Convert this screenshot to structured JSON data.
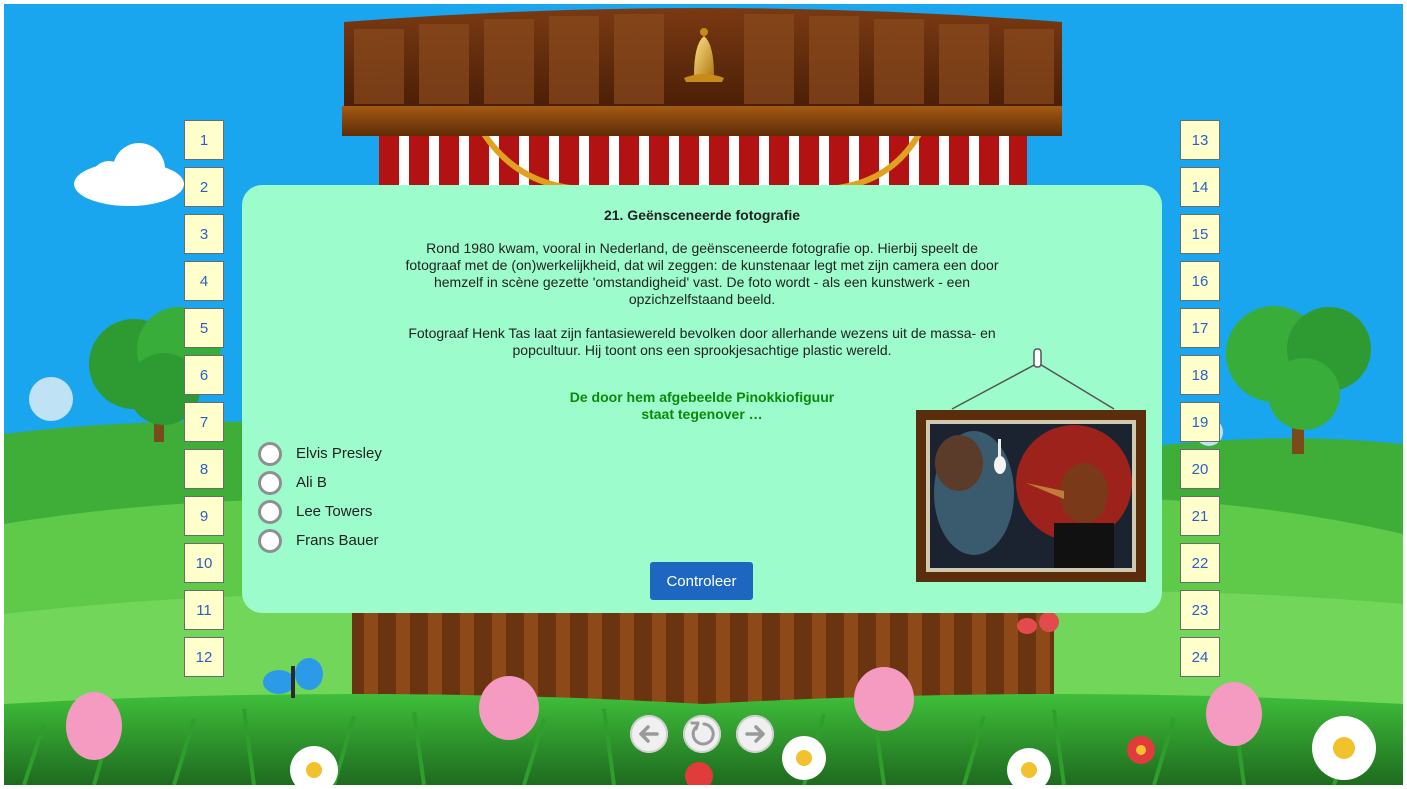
{
  "question": {
    "title": "21. Geënsceneerde fotografie",
    "paragraph1": "Rond 1980 kwam, vooral in Nederland, de geënsceneerde fotografie op. Hierbij speelt de fotograaf met de (on)werkelijkheid, dat wil zeggen: de kunstenaar legt met zijn camera een door hemzelf in scène gezette 'omstandigheid' vast. De foto wordt - als een kunstwerk - een opzichzelfstaand beeld.",
    "paragraph2": "Fotograaf Henk Tas laat zijn fantasiewereld bevolken door allerhande wezens uit de massa- en popcultuur. Hij toont ons een sprookjesachtige plastic wereld.",
    "prompt": "De door hem afgebeelde Pinokkiofiguur\nstaat tegenover …",
    "options": [
      "Elvis Presley",
      "Ali B",
      "Lee Towers",
      "Frans Bauer"
    ],
    "check_label": "Controleer"
  },
  "left_numbers": [
    "1",
    "2",
    "3",
    "4",
    "5",
    "6",
    "7",
    "8",
    "9",
    "10",
    "11",
    "12"
  ],
  "right_numbers": [
    "13",
    "14",
    "15",
    "16",
    "17",
    "18",
    "19",
    "20",
    "21",
    "22",
    "23",
    "24"
  ],
  "nav": {
    "prev_icon": "arrow-left-icon",
    "restart_icon": "restart-icon",
    "next_icon": "arrow-right-icon"
  },
  "colors": {
    "sky": "#19a6ee",
    "panel": "#9dfccb",
    "number_bg": "#ffffcc",
    "number_text": "#2b5fc7",
    "button": "#1e67c0",
    "prompt": "#0a8a0a"
  }
}
